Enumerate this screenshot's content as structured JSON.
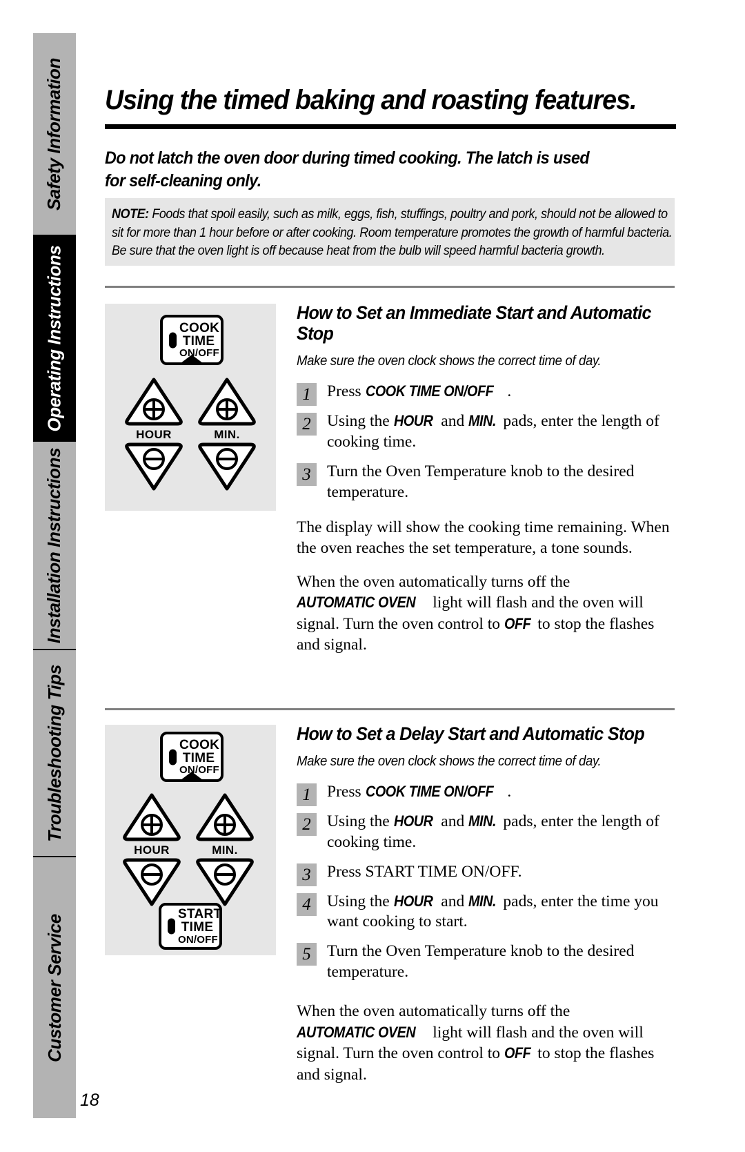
{
  "sidebar": {
    "tabs": [
      {
        "label": "Safety Information",
        "active": false
      },
      {
        "label": "Operating Instructions",
        "active": true
      },
      {
        "label": "Installation Instructions",
        "active": false
      },
      {
        "label": "Troubleshooting Tips",
        "active": false
      },
      {
        "label": "Customer Service",
        "active": false
      }
    ]
  },
  "page": {
    "title": "Using the timed baking and roasting features.",
    "intro": "Do not latch the oven door during timed cooking. The latch is used for self-cleaning only.",
    "note_lead": "NOTE:",
    "note_body": " Foods that spoil easily, such as milk, eggs, fish, stuffings, poultry and pork, should not be allowed to sit for more than 1 hour before or after cooking. Room temperature promotes the growth of harmful bacteria. Be sure that the oven light is off because heat from the bulb will speed harmful bacteria growth.",
    "page_number": "18"
  },
  "panel1": {
    "cook_time_pad": {
      "line1": "COOK",
      "line2": "TIME",
      "line3": "ON/OFF"
    },
    "hour_label": "HOUR",
    "min_label": "MIN.",
    "plus_icon": "plus-icon",
    "minus_icon": "minus-icon"
  },
  "panel2": {
    "cook_time_pad": {
      "line1": "COOK",
      "line2": "TIME",
      "line3": "ON/OFF"
    },
    "start_time_pad": {
      "line1": "START",
      "line2": "TIME",
      "line3": "ON/OFF"
    },
    "hour_label": "HOUR",
    "min_label": "MIN.",
    "plus_icon": "plus-icon",
    "minus_icon": "minus-icon"
  },
  "section1": {
    "heading": "How to Set an Immediate Start and Automatic Stop",
    "caption": "Make sure the oven clock shows the correct time of day.",
    "steps": [
      {
        "num": "1",
        "parts": [
          {
            "text": "Press ",
            "style": "normal"
          },
          {
            "text": "COOK TIME ON/OFF",
            "style": "cond"
          },
          {
            "text": ".",
            "style": "normal"
          }
        ]
      },
      {
        "num": "2",
        "parts": [
          {
            "text": "Using the ",
            "style": "normal"
          },
          {
            "text": "HOUR",
            "style": "cond"
          },
          {
            "text": " and ",
            "style": "normal"
          },
          {
            "text": "MIN.",
            "style": "cond"
          },
          {
            "text": " pads, enter the length of cooking time.",
            "style": "normal"
          }
        ]
      },
      {
        "num": "3",
        "parts": [
          {
            "text": "Turn the Oven Temperature knob to the desired temperature.",
            "style": "normal"
          }
        ]
      }
    ],
    "paragraph1": "The display will show the cooking time remaining. When the oven reaches the set temperature, a tone sounds.",
    "paragraph2_parts": [
      {
        "text": "When the oven automatically turns off the ",
        "style": "normal"
      },
      {
        "text": "AUTOMATIC OVEN",
        "style": "cond"
      },
      {
        "text": " light will flash and the oven will signal. Turn the oven control to ",
        "style": "normal"
      },
      {
        "text": "OFF",
        "style": "cond"
      },
      {
        "text": " to stop the flashes and signal.",
        "style": "normal"
      }
    ]
  },
  "section2": {
    "heading": "How to Set a Delay Start and Automatic Stop",
    "caption": "Make sure the oven clock shows the correct time of day.",
    "steps": [
      {
        "num": "1",
        "parts": [
          {
            "text": "Press ",
            "style": "normal"
          },
          {
            "text": "COOK TIME ON/OFF",
            "style": "cond"
          },
          {
            "text": ".",
            "style": "normal"
          }
        ]
      },
      {
        "num": "2",
        "parts": [
          {
            "text": "Using the ",
            "style": "normal"
          },
          {
            "text": "HOUR",
            "style": "cond"
          },
          {
            "text": " and ",
            "style": "normal"
          },
          {
            "text": "MIN.",
            "style": "cond"
          },
          {
            "text": " pads, enter the length of cooking time.",
            "style": "normal"
          }
        ]
      },
      {
        "num": "3",
        "parts": [
          {
            "text": "Press START TIME ON/OFF.",
            "style": "normal"
          }
        ]
      },
      {
        "num": "4",
        "parts": [
          {
            "text": "Using the ",
            "style": "normal"
          },
          {
            "text": "HOUR",
            "style": "cond"
          },
          {
            "text": " and ",
            "style": "normal"
          },
          {
            "text": "MIN.",
            "style": "cond"
          },
          {
            "text": " pads, enter the time you want cooking to start.",
            "style": "normal"
          }
        ]
      },
      {
        "num": "5",
        "parts": [
          {
            "text": "Turn the Oven Temperature knob to the desired temperature.",
            "style": "normal"
          }
        ]
      }
    ],
    "paragraph1_parts": [
      {
        "text": "When the oven automatically turns off the ",
        "style": "normal"
      },
      {
        "text": "AUTOMATIC OVEN",
        "style": "cond"
      },
      {
        "text": " light will flash and the oven will signal. Turn the oven control to ",
        "style": "normal"
      },
      {
        "text": "OFF",
        "style": "cond"
      },
      {
        "text": " to stop the flashes and signal.",
        "style": "normal"
      }
    ]
  }
}
